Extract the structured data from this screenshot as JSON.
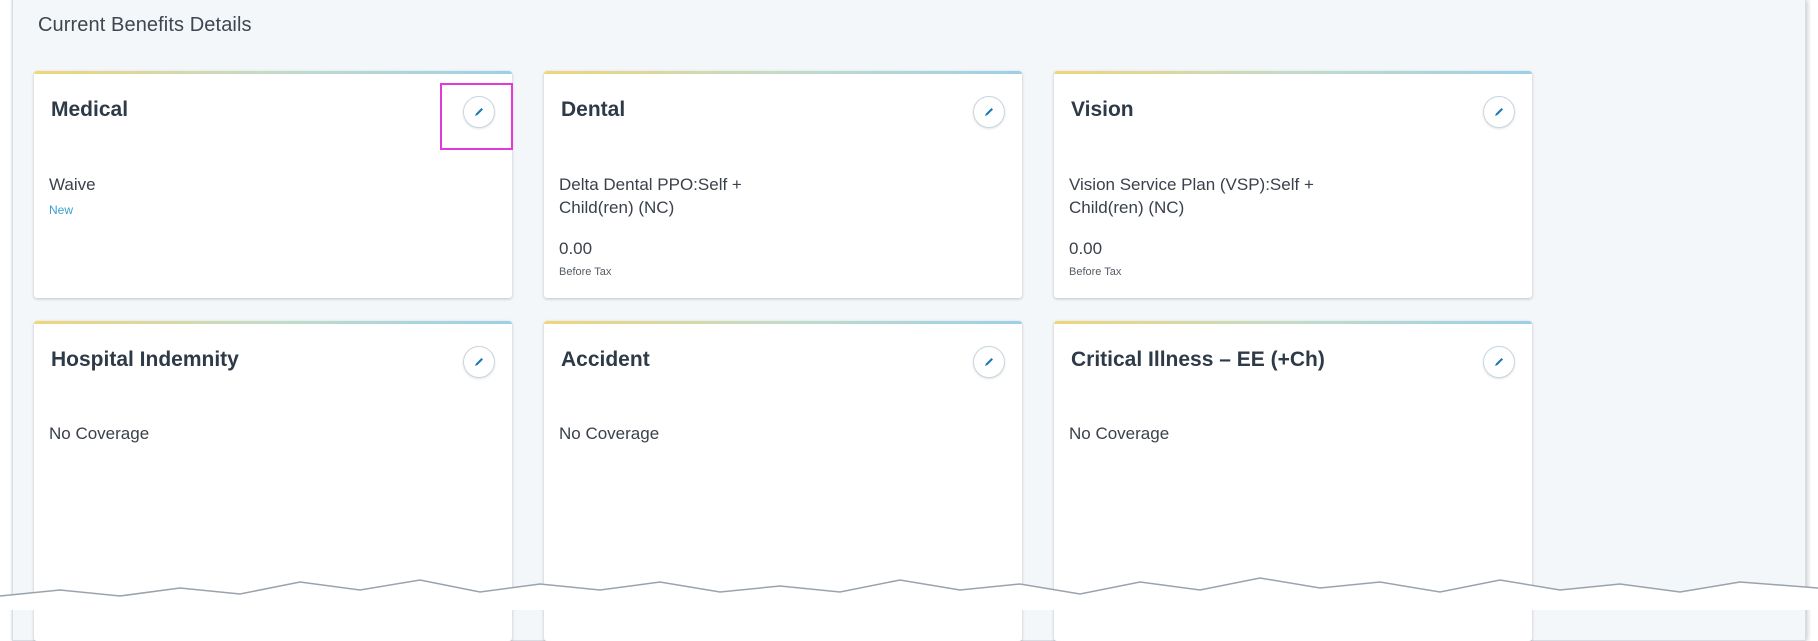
{
  "section": {
    "title": "Current Benefits Details"
  },
  "cards": [
    {
      "title": "Medical",
      "plan": "Waive",
      "status": "New"
    },
    {
      "title": "Dental",
      "plan": "Delta Dental PPO:Self + Child(ren) (NC)",
      "amount": "0.00",
      "tax_label": "Before Tax"
    },
    {
      "title": "Vision",
      "plan": "Vision Service Plan (VSP):Self + Child(ren) (NC)",
      "amount": "0.00",
      "tax_label": "Before Tax"
    },
    {
      "title": "Hospital Indemnity",
      "plan": "No Coverage"
    },
    {
      "title": "Accident",
      "plan": "No Coverage"
    },
    {
      "title": "Critical Illness – EE (+Ch)",
      "plan": "No Coverage"
    }
  ],
  "icons": {
    "edit": "pencil-icon"
  },
  "colors": {
    "accent_gold": "#f0d57a",
    "accent_blue": "#9bd0e8",
    "link_blue": "#3a9fd1",
    "highlight_magenta": "#e23ad8"
  }
}
